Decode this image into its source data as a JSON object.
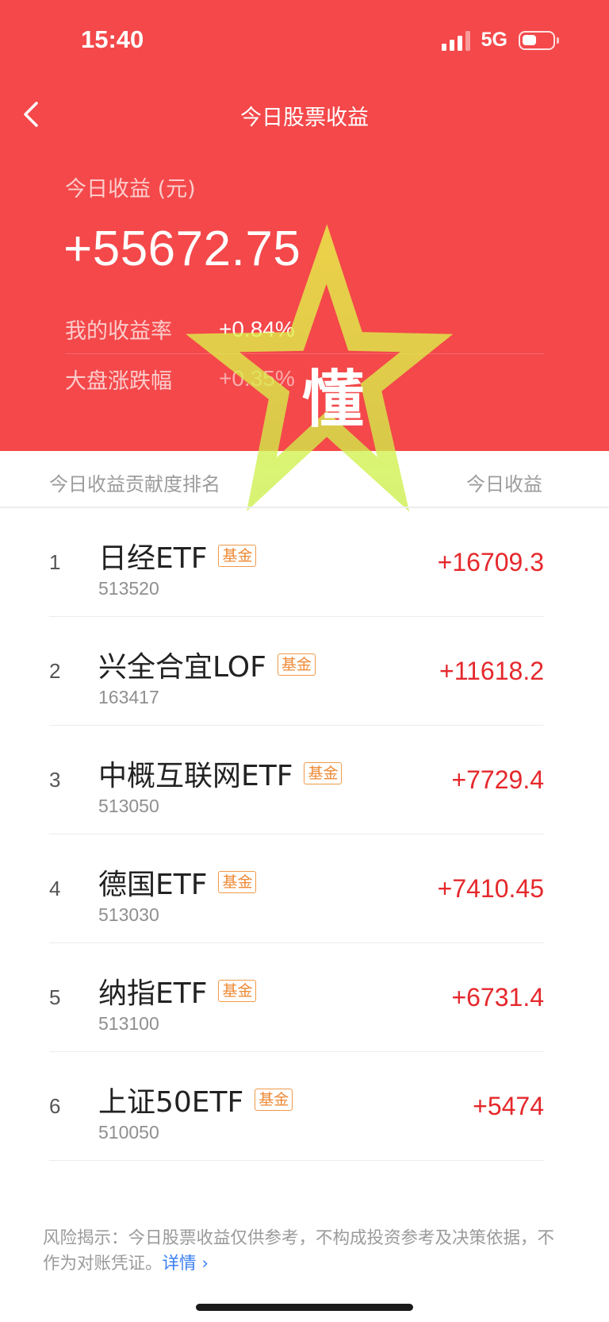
{
  "status_bar": {
    "time": "15:40",
    "network": "5G"
  },
  "nav": {
    "title": "今日股票收益"
  },
  "summary": {
    "earn_label": "今日收益 (元)",
    "earn_value": "+55672.75",
    "my_rate_label": "我的收益率",
    "my_rate_value": "+0.84%",
    "market_label": "大盘涨跌幅",
    "market_value": "+0.35%"
  },
  "watermark": {
    "text": "懂"
  },
  "list_header": {
    "left": "今日收益贡献度排名",
    "right": "今日收益"
  },
  "items": [
    {
      "rank": "1",
      "name": "日经ETF",
      "tag": "基金",
      "code": "513520",
      "profit": "+16709.3"
    },
    {
      "rank": "2",
      "name": "兴全合宜LOF",
      "tag": "基金",
      "code": "163417",
      "profit": "+11618.2"
    },
    {
      "rank": "3",
      "name": "中概互联网ETF",
      "tag": "基金",
      "code": "513050",
      "profit": "+7729.4"
    },
    {
      "rank": "4",
      "name": "德国ETF",
      "tag": "基金",
      "code": "513030",
      "profit": "+7410.45"
    },
    {
      "rank": "5",
      "name": "纳指ETF",
      "tag": "基金",
      "code": "513100",
      "profit": "+6731.4"
    },
    {
      "rank": "6",
      "name": "上证50ETF",
      "tag": "基金",
      "code": "510050",
      "profit": "+5474"
    }
  ],
  "disclaimer": {
    "text": "风险揭示：今日股票收益仅供参考，不构成投资参考及决策依据，不作为对账凭证。",
    "link": "详情 ›"
  },
  "colors": {
    "hero_bg": "#f4484a",
    "profit": "#e5282c",
    "tag": "#ee8a36",
    "link": "#3a7ff2"
  }
}
